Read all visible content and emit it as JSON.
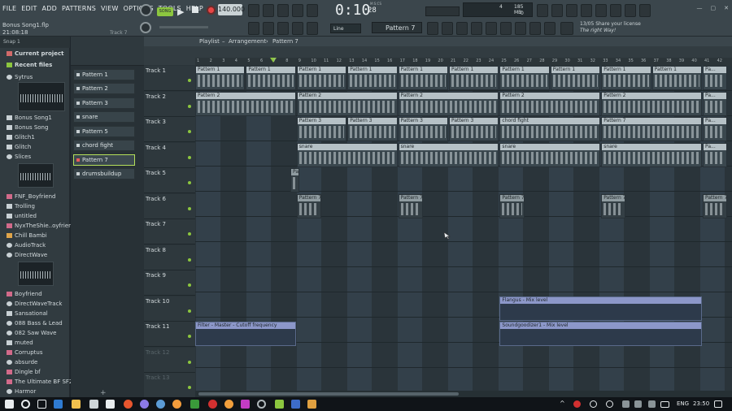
{
  "menu": [
    "FILE",
    "EDIT",
    "ADD",
    "PATTERNS",
    "VIEW",
    "OPTIONS",
    "TOOLS",
    "HELP"
  ],
  "project": {
    "file": "Bonus Song1.flp",
    "time": "21:08:18",
    "hint": "Track 7"
  },
  "transport": {
    "mode": "SONG",
    "tempo": "140.000",
    "time_main": "0:10",
    "time_sub": "28",
    "time_unit": "M:S:CS"
  },
  "cpu": {
    "cpu": "4",
    "mem": "185 MB",
    "zero": "0"
  },
  "snap": "Line",
  "pattern_selector": "Pattern 7",
  "news": {
    "line1": "13/05  Share your license",
    "line2": "The right Way!"
  },
  "browser": {
    "toolbar": "Snap 1",
    "items": [
      "Current project",
      "Recent files",
      "Sytrus",
      "Bonus Song1",
      "Bonus Song",
      "Glitch1",
      "Glitch",
      "Slices",
      "FNF_Boyfriend",
      "Trolling",
      "untitled",
      "NyxTheShie..oyfriend",
      "Chill Bambi",
      "AudioTrack",
      "DirectWave",
      "Boyfriend",
      "DirectWaveTrack",
      "Sansational",
      "088 Bass & Lead",
      "082 Saw Wave",
      "muted",
      "Corruptus",
      "absurde",
      "Dingle bf",
      "The Ultimate BF SF2",
      "Harmor"
    ]
  },
  "patterns": [
    "Pattern 1",
    "Pattern 2",
    "Pattern 3",
    "snare",
    "Pattern 5",
    "chord fight",
    "Pattern 7",
    "drumsbuildup"
  ],
  "playlist": {
    "title_parts": [
      "Playlist",
      "Arrangement",
      "Pattern 7"
    ],
    "ruler": [
      "1",
      "2",
      "3",
      "4",
      "5",
      "6",
      "7",
      "8",
      "9",
      "10",
      "11",
      "12",
      "13",
      "14",
      "15",
      "16",
      "17",
      "18",
      "19",
      "20",
      "21",
      "22",
      "23",
      "24",
      "25",
      "26",
      "27",
      "28",
      "29",
      "30",
      "31",
      "32",
      "33",
      "34",
      "35",
      "36",
      "37",
      "38",
      "39",
      "40",
      "41",
      "42"
    ],
    "tracks": [
      "Track 1",
      "Track 2",
      "Track 3",
      "Track 4",
      "Track 5",
      "Track 6",
      "Track 7",
      "Track 8",
      "Track 9",
      "Track 10",
      "Track 11",
      "Track 12",
      "Track 13"
    ],
    "clip_names": {
      "p1": "Pattern 1",
      "p2": "Pattern 2",
      "p3": "Pattern 3",
      "chord": "chord fight",
      "snare": "snare",
      "p7": "Pattern 7",
      "pa": "Pa...",
      "filter": "Filter - Master - Cutoff frequency",
      "flangus": "Flangus - Mix level",
      "sound": "Soundgoodizer1 - Mix level"
    }
  },
  "taskbar": {
    "lang": "ENG",
    "clock": "23:50"
  }
}
